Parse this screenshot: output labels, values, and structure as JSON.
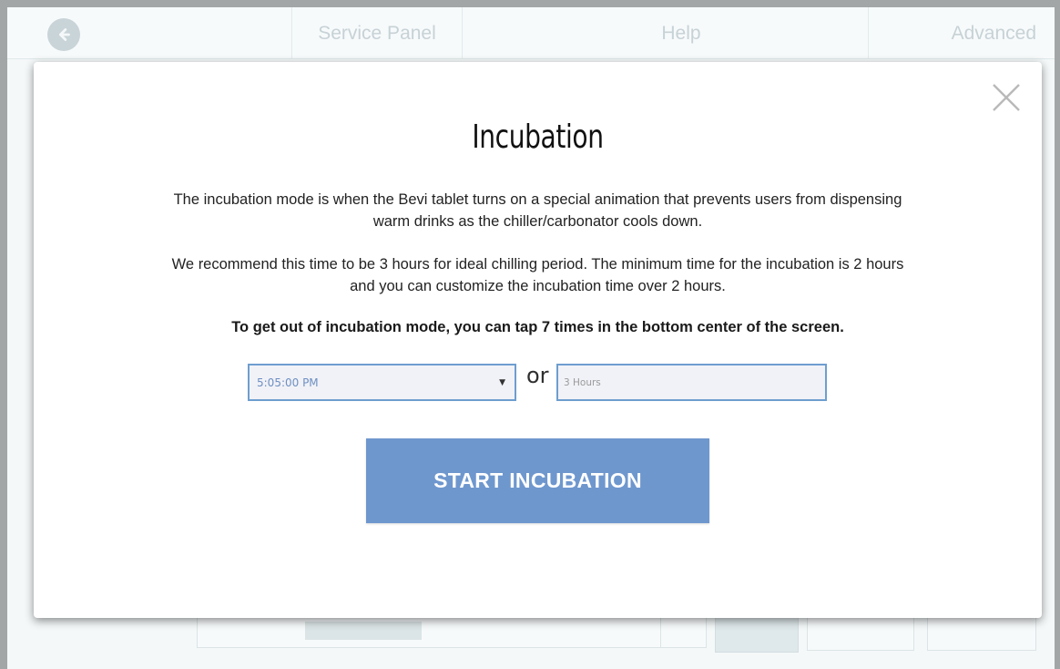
{
  "background": {
    "tabs": {
      "service_panel": "Service Panel",
      "help": "Help",
      "advanced": "Advanced"
    }
  },
  "modal": {
    "title": "Incubation",
    "paragraph_1": "The incubation mode is when the Bevi tablet turns on a special animation that prevents users from dispensing warm drinks as the chiller/carbonator cools down.",
    "paragraph_2": "We recommend this time to be 3 hours for ideal chilling period. The minimum time for the incubation is 2 hours and you can customize the incubation time over 2 hours.",
    "paragraph_3": "To get out of incubation mode, you can tap 7 times in the bottom center of the screen.",
    "time_select_value": "5:05:00 PM",
    "or_label": "or",
    "hours_placeholder": "3 Hours",
    "start_button": "START INCUBATION"
  },
  "colors": {
    "accent": "#6e97ce",
    "input_border": "#6e9ecf"
  },
  "icons": {
    "back": "back-arrow-icon",
    "close": "close-icon",
    "select": "dropdown-arrow-icon"
  }
}
